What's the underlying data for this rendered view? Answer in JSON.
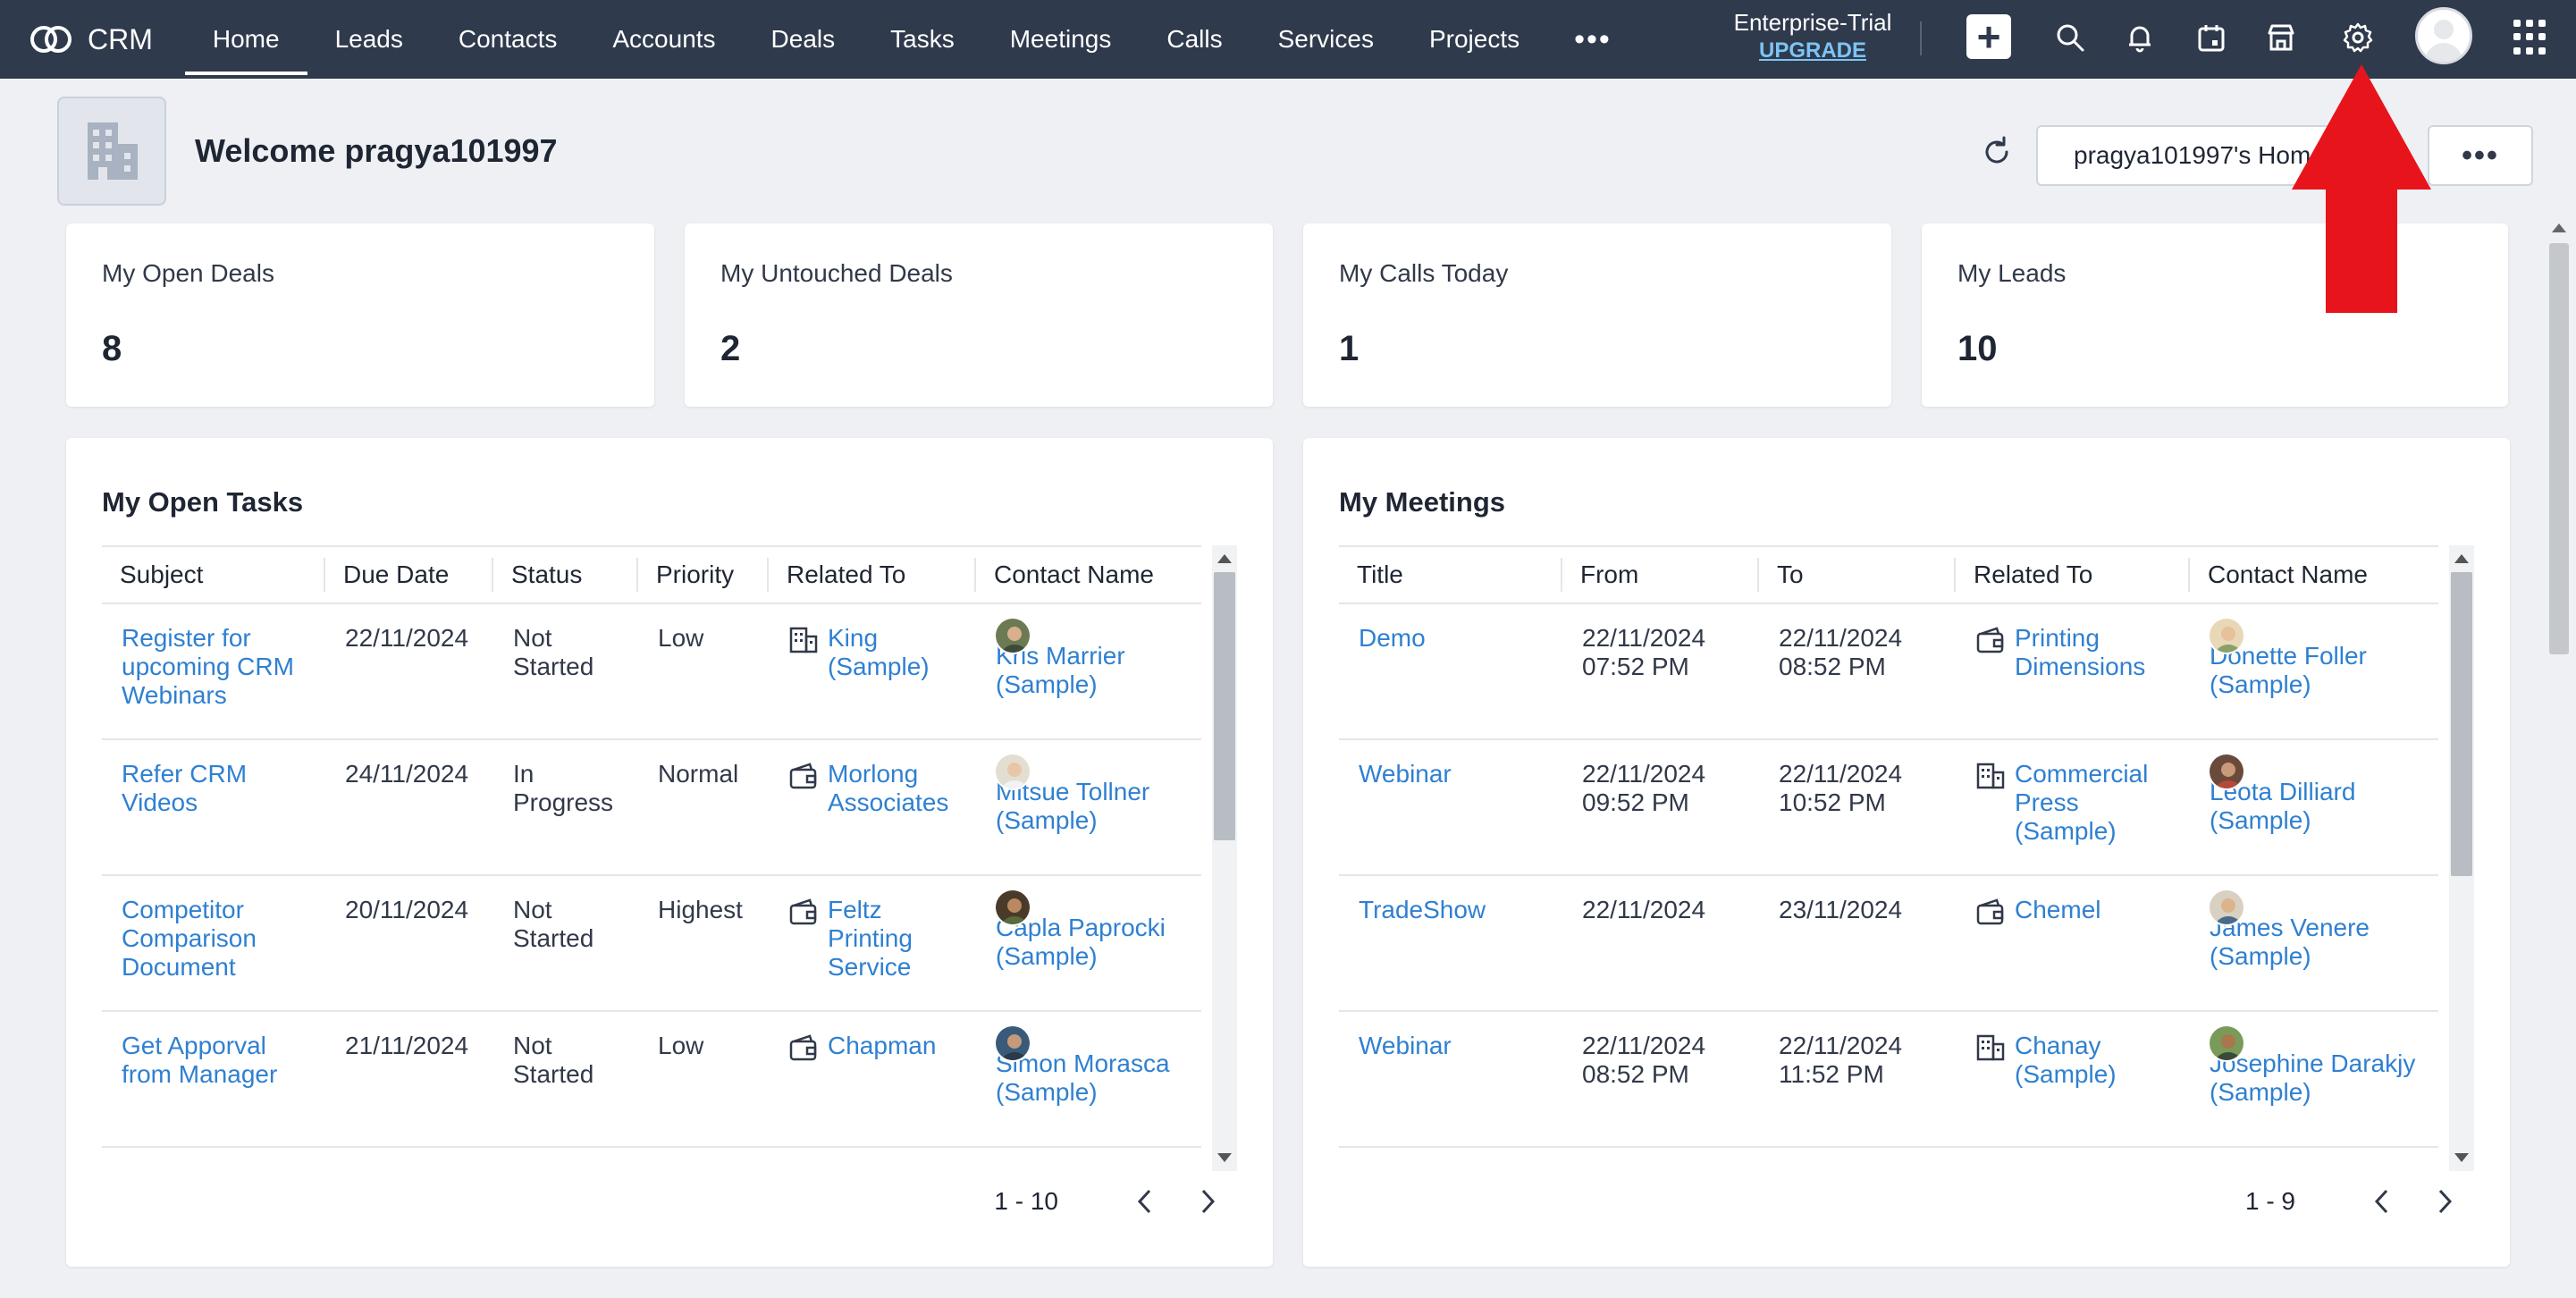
{
  "app": {
    "brand": "CRM",
    "nav_tabs": [
      "Home",
      "Leads",
      "Contacts",
      "Accounts",
      "Deals",
      "Tasks",
      "Meetings",
      "Calls",
      "Services",
      "Projects"
    ],
    "more_label": "•••",
    "trial_label": "Enterprise-Trial",
    "upgrade_label": "UPGRADE",
    "create_label": "+"
  },
  "header": {
    "welcome": "Welcome pragya101997",
    "home_view": "pragya101997's Home",
    "more_label": "•••"
  },
  "kpis": [
    {
      "label": "My Open Deals",
      "value": "8"
    },
    {
      "label": "My Untouched Deals",
      "value": "2"
    },
    {
      "label": "My Calls Today",
      "value": "1"
    },
    {
      "label": "My Leads",
      "value": "10"
    }
  ],
  "tasks": {
    "title": "My Open Tasks",
    "columns": [
      "Subject",
      "Due Date",
      "Status",
      "Priority",
      "Related To",
      "Contact Name"
    ],
    "rows": [
      {
        "subject": "Register for upcoming CRM Webinars",
        "due": "22/11/2024",
        "status": "Not Started",
        "priority": "Low",
        "related": "King (Sample)",
        "related_icon": "building-icon",
        "contact": "Kris Marrier (Sample)"
      },
      {
        "subject": "Refer CRM Videos",
        "due": "24/11/2024",
        "status": "In Progress",
        "priority": "Normal",
        "related": "Morlong Associates",
        "related_icon": "wallet-icon",
        "contact": "Mitsue Tollner (Sample)"
      },
      {
        "subject": "Competitor Comparison Document",
        "due": "20/11/2024",
        "status": "Not Started",
        "priority": "Highest",
        "related": "Feltz Printing Service",
        "related_icon": "wallet-icon",
        "contact": "Capla Paprocki (Sample)"
      },
      {
        "subject": "Get Apporval from Manager",
        "due": "21/11/2024",
        "status": "Not Started",
        "priority": "Low",
        "related": "Chapman",
        "related_icon": "wallet-icon",
        "contact": "Simon Morasca (Sample)"
      }
    ],
    "pager": "1 - 10"
  },
  "meetings": {
    "title": "My Meetings",
    "columns": [
      "Title",
      "From",
      "To",
      "Related To",
      "Contact Name"
    ],
    "rows": [
      {
        "title": "Demo",
        "from": "22/11/2024 07:52 PM",
        "to": "22/11/2024 08:52 PM",
        "related": "Printing Dimensions",
        "related_icon": "wallet-icon",
        "contact": "Donette Foller (Sample)"
      },
      {
        "title": "Webinar",
        "from": "22/11/2024 09:52 PM",
        "to": "22/11/2024 10:52 PM",
        "related": "Commercial Press (Sample)",
        "related_icon": "building-icon",
        "contact": "Leota Dilliard (Sample)"
      },
      {
        "title": "TradeShow",
        "from": "22/11/2024",
        "to": "23/11/2024",
        "related": "Chemel",
        "related_icon": "wallet-icon",
        "contact": "James Venere (Sample)"
      },
      {
        "title": "Webinar",
        "from": "22/11/2024 08:52 PM",
        "to": "22/11/2024 11:52 PM",
        "related": "Chanay (Sample)",
        "related_icon": "building-icon",
        "contact": "Josephine Darakjy (Sample)"
      }
    ],
    "pager": "1 - 9"
  },
  "colors": {
    "nav_bg": "#2f3a4c",
    "link": "#2f80d1",
    "annotation_arrow": "#e8141c"
  }
}
